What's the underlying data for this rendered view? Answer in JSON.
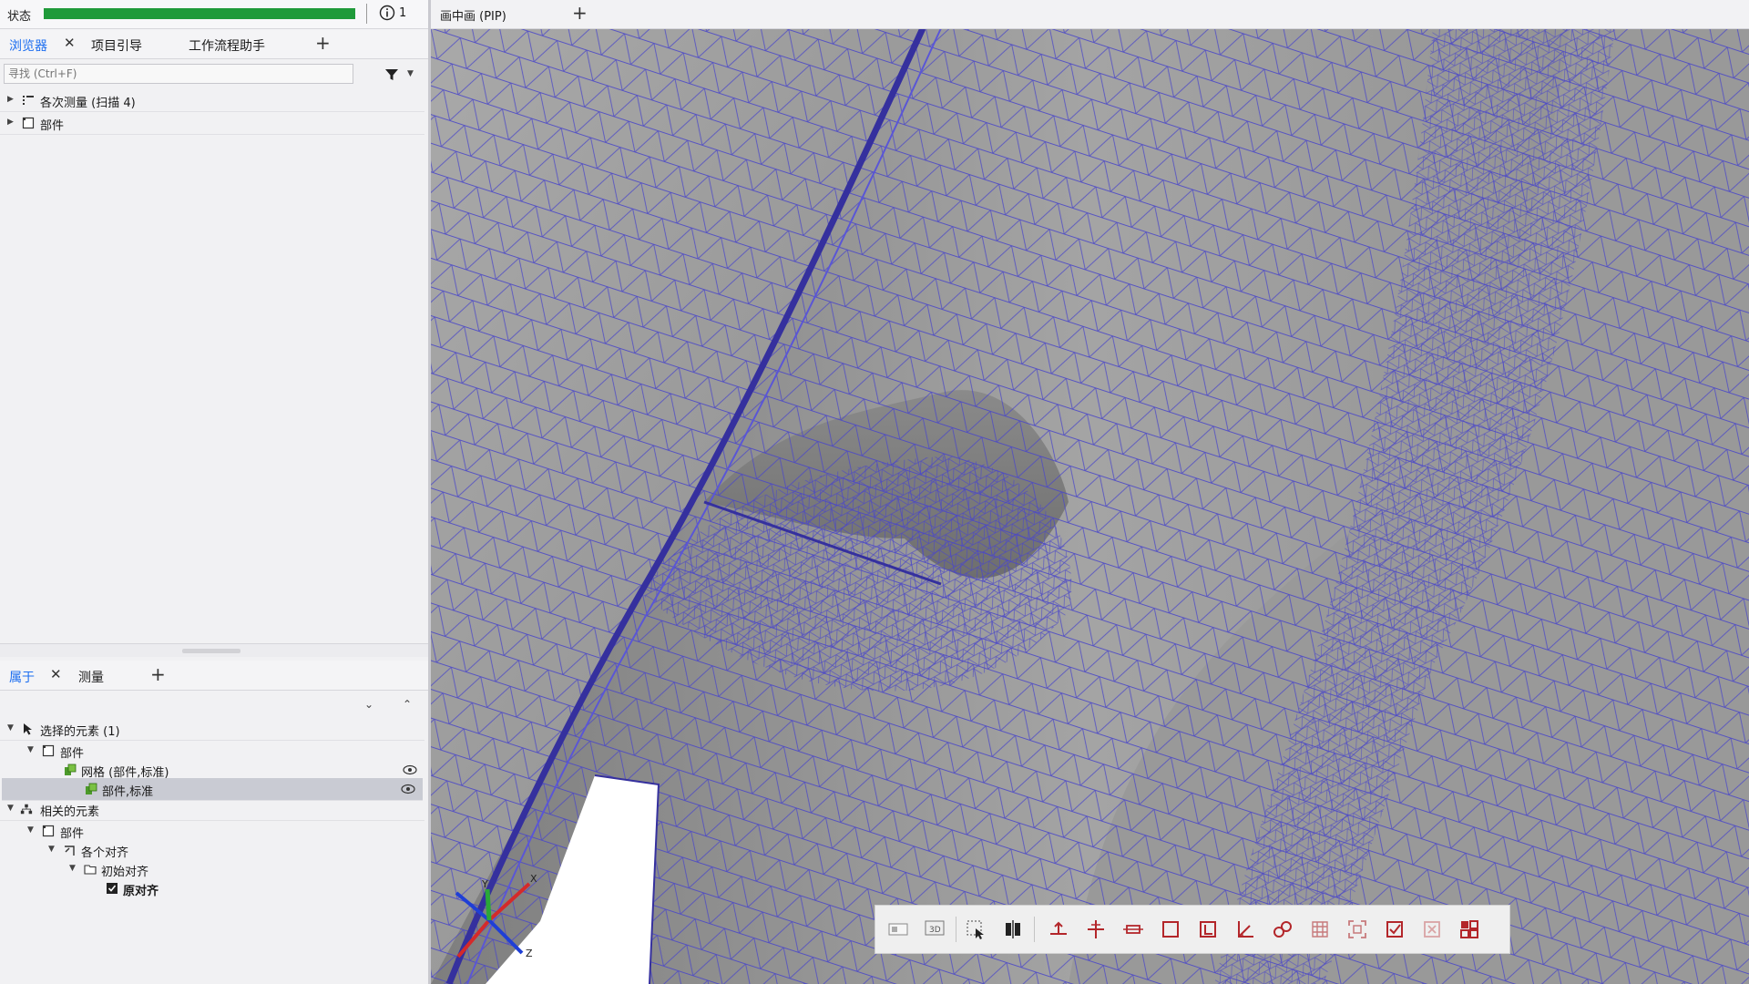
{
  "status": {
    "label": "状态",
    "progress": 1.0,
    "info_count": "1"
  },
  "browser_tabs": {
    "items": [
      {
        "label": "浏览器",
        "active": true,
        "closable": true
      },
      {
        "label": "项目引导",
        "active": false
      },
      {
        "label": "工作流程助手",
        "active": false
      }
    ],
    "add": "+"
  },
  "search": {
    "placeholder": "寻找 (Ctrl+F)",
    "value": ""
  },
  "browser_tree": [
    {
      "label": "各次测量 (扫描 4)",
      "icon": "measurements-icon"
    },
    {
      "label": "部件",
      "icon": "part-icon"
    }
  ],
  "props_tabs": {
    "items": [
      {
        "label": "属于",
        "active": true,
        "closable": true
      },
      {
        "label": "测量",
        "active": false
      }
    ],
    "add": "+"
  },
  "props_tree": {
    "selected_group": "选择的元素 (1)",
    "part1": "部件",
    "mesh": "网格 (部件,标准)",
    "part_std": "部件,标准",
    "related_group": "相关的元素",
    "part2": "部件",
    "alignments": "各个对齐",
    "initial_alignment": "初始对齐",
    "original_alignment": "原对齐"
  },
  "viewport": {
    "pip_tab": "画中画 (PIP)",
    "add": "+",
    "mesh_color": "#4a46c8",
    "surface_color": "#9a9a9a"
  },
  "toolbar_icons": [
    "view-2d-icon",
    "view-3d-icon",
    "select-box-icon",
    "align-icon",
    "section-icon",
    "crosshair-icon",
    "dimension-icon",
    "rectangle-icon",
    "frame-icon",
    "angle-icon",
    "link-icon",
    "grid-icon",
    "fit-icon",
    "check-icon",
    "deselect-icon",
    "layout-icon"
  ],
  "triad_labels": {
    "x": "X",
    "y": "Y",
    "z": "Z"
  },
  "colors": {
    "accent": "#1e6ff0",
    "progress": "#1f9a3a",
    "toolbar_red": "#b3262a"
  }
}
